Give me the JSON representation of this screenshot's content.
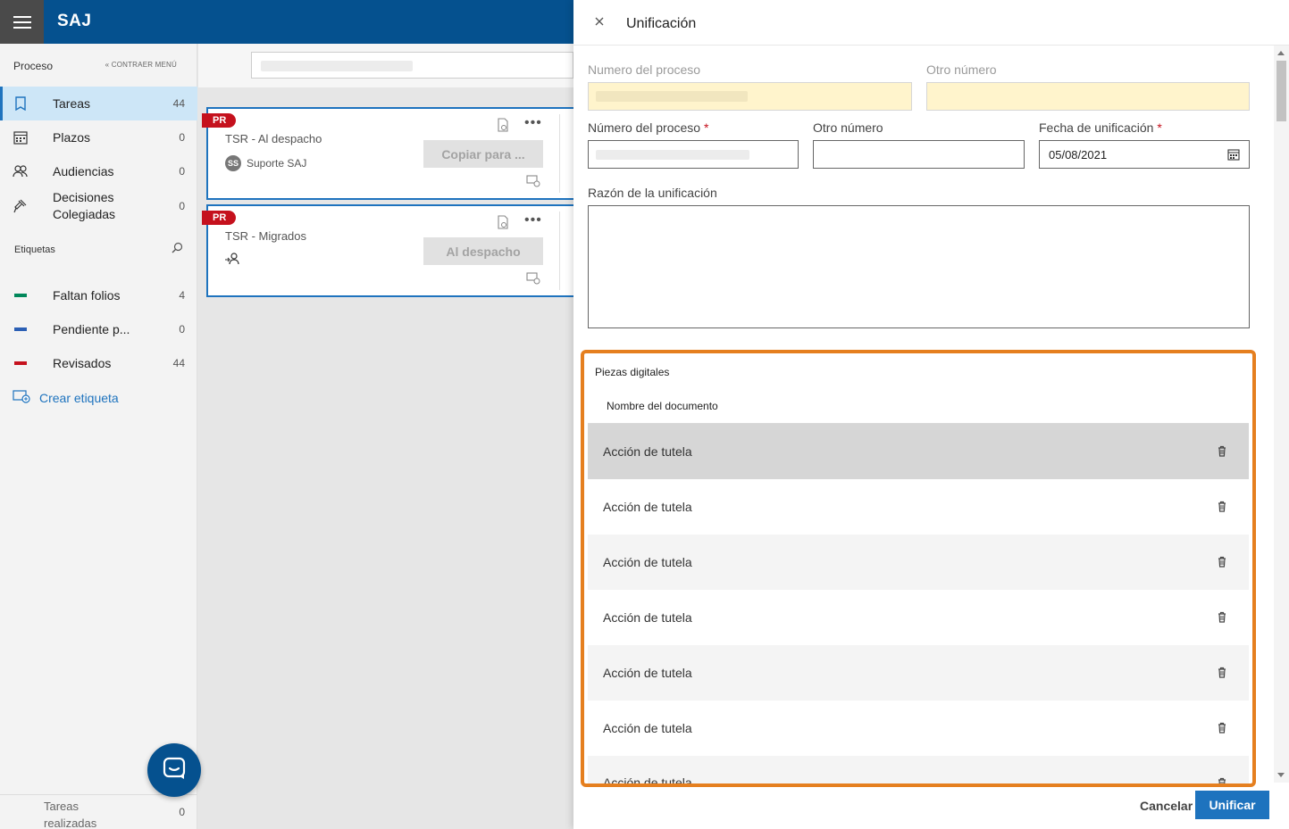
{
  "app": {
    "name": "SAJ"
  },
  "sidebar": {
    "section_title": "Proceso",
    "collapse_label": "CONTRAER MENÚ",
    "items": [
      {
        "label": "Tareas",
        "count": "44",
        "icon": "bookmark-icon"
      },
      {
        "label": "Plazos",
        "count": "0",
        "icon": "calendar-icon"
      },
      {
        "label": "Audiencias",
        "count": "0",
        "icon": "people-icon"
      },
      {
        "label": "Decisiones Colegiadas",
        "count": "0",
        "icon": "gavel-icon"
      }
    ],
    "tags_title": "Etiquetas",
    "tags": [
      {
        "label": "Faltan folios",
        "count": "4",
        "color": "#00875a"
      },
      {
        "label": "Pendiente p...",
        "count": "0",
        "color": "#2b5fb4"
      },
      {
        "label": "Revisados",
        "count": "44",
        "color": "#c5111d"
      }
    ],
    "create_tag_label": "Crear etiqueta",
    "bottom_item": {
      "label": "Tareas realizadas",
      "count": "0"
    }
  },
  "cards": [
    {
      "tag": "PR",
      "title": "TSR - Al despacho",
      "assignee_initials": "SS",
      "assignee": "Suporte SAJ",
      "action_label": "Copiar para ..."
    },
    {
      "tag": "PR",
      "title": "TSR - Migrados",
      "assignee_initials": "",
      "assignee": "",
      "action_label": "Al despacho"
    }
  ],
  "panel": {
    "title": "Unificación",
    "field_labels": {
      "process_number_top": "Numero del proceso",
      "other_number_top": "Otro número",
      "process_number": "Número del proceso",
      "other_number": "Otro número",
      "unification_date": "Fecha de unificación",
      "reason": "Razón de la unificación"
    },
    "required_mark": "*",
    "unification_date_value": "05/08/2021",
    "pieces": {
      "title": "Piezas digitales",
      "column_header": "Nombre del documento",
      "rows": [
        "Acción de tutela",
        "Acción de tutela",
        "Acción de tutela",
        "Acción de tutela",
        "Acción de tutela",
        "Acción de tutela",
        "Acción de tutela"
      ]
    },
    "cancel_label": "Cancelar",
    "submit_label": "Unificar"
  },
  "colors": {
    "brand": "#05518f",
    "accent": "#1e73be",
    "highlight": "#e57f1f",
    "tag_red": "#c5111d"
  }
}
